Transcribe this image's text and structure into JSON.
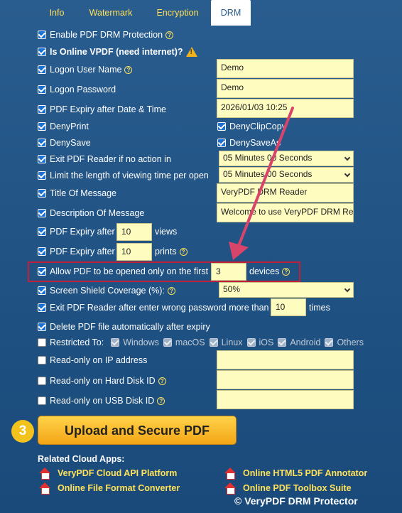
{
  "tabs": [
    "Info",
    "Watermark",
    "Encryption",
    "DRM"
  ],
  "opts": {
    "enable": "Enable PDF DRM Protection",
    "online": "Is Online VPDF (need internet)?",
    "user": "Logon User Name",
    "pass": "Logon Password",
    "expiry_date": "PDF Expiry after Date & Time",
    "deny_print": "DenyPrint",
    "deny_clip": "DenyClipCopy",
    "deny_save": "DenySave",
    "deny_saveas": "DenySaveAs",
    "exit_reader": "Exit PDF Reader if no action in",
    "limit_time": "Limit the length of viewing time per open",
    "title_msg": "Title Of Message",
    "desc_msg": "Description Of Message",
    "expiry_views": "PDF Expiry after",
    "views": "views",
    "expiry_prints": "PDF Expiry after",
    "prints": "prints",
    "allow_devices": "Allow PDF to be opened only on the first",
    "devices": "devices",
    "screen_shield": "Screen Shield Coverage (%):",
    "exit_wrong": "Exit PDF Reader after enter wrong password more than",
    "times": "times",
    "delete_file": "Delete PDF file automatically after expiry",
    "restricted": "Restricted To:",
    "ro_ip": "Read-only on IP address",
    "ro_hdd": "Read-only on Hard Disk ID",
    "ro_usb": "Read-only on USB Disk ID"
  },
  "os": [
    "Windows",
    "macOS",
    "Linux",
    "iOS",
    "Android",
    "Others"
  ],
  "values": {
    "user": "Demo",
    "pass": "Demo",
    "date": "2026/01/03 10:25",
    "exit_sel": "05 Minutes 00 Seconds",
    "limit_sel": "05 Minutes 00 Seconds",
    "title": "VeryPDF DRM Reader",
    "desc": "Welcome to use VeryPDF DRM Re",
    "views": "10",
    "prints": "10",
    "devices": "3",
    "shield": "50%",
    "wrong": "10"
  },
  "upload": {
    "step": "3",
    "label": "Upload and Secure PDF"
  },
  "related": "Related Cloud Apps:",
  "links": [
    "VeryPDF Cloud API Platform",
    "Online HTML5 PDF Annotator",
    "Online File Format Converter",
    "Online PDF Toolbox Suite"
  ],
  "copyright": "© VeryPDF DRM Protector"
}
